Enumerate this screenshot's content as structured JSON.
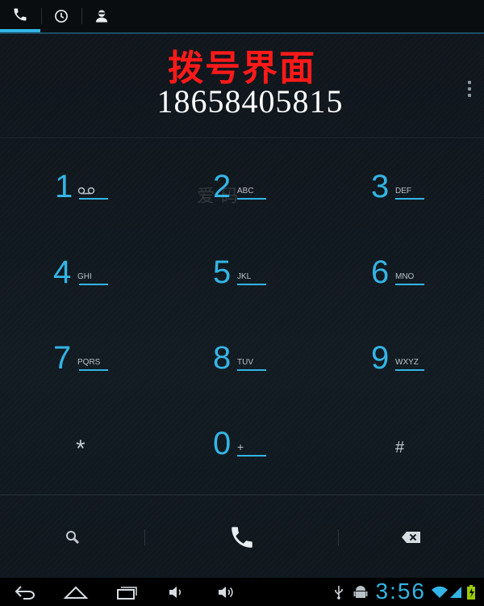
{
  "tabs": [
    {
      "icon": "phone-icon",
      "active": true
    },
    {
      "icon": "clock-icon",
      "active": false
    },
    {
      "icon": "contact-icon",
      "active": false
    }
  ],
  "title": "拨号界面",
  "dialed_number": "18658405815",
  "watermark": "爱 码",
  "keypad": {
    "keys": [
      {
        "digit": "1",
        "letters": ""
      },
      {
        "digit": "2",
        "letters": "ABC"
      },
      {
        "digit": "3",
        "letters": "DEF"
      },
      {
        "digit": "4",
        "letters": "GHI"
      },
      {
        "digit": "5",
        "letters": "JKL"
      },
      {
        "digit": "6",
        "letters": "MNO"
      },
      {
        "digit": "7",
        "letters": "PQRS"
      },
      {
        "digit": "8",
        "letters": "TUV"
      },
      {
        "digit": "9",
        "letters": "WXYZ"
      },
      {
        "digit": "*",
        "letters": ""
      },
      {
        "digit": "0",
        "letters": "+"
      },
      {
        "digit": "#",
        "letters": ""
      }
    ]
  },
  "actions": {
    "search_icon": "search-icon",
    "call_icon": "call-icon",
    "delete_icon": "backspace-icon"
  },
  "status_bar": {
    "time": "3:56"
  },
  "colors": {
    "accent": "#33b5e5",
    "title_red": "#ff1a1a",
    "battery_green": "#99cc00"
  }
}
